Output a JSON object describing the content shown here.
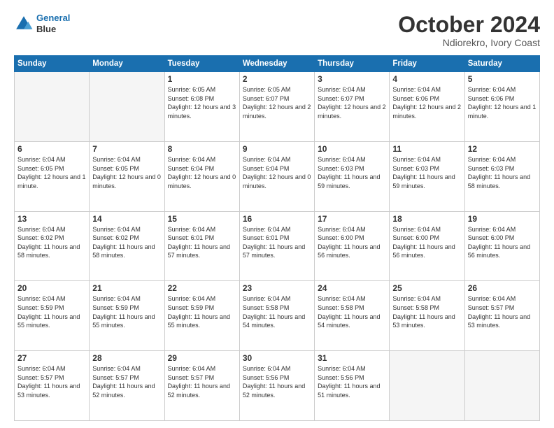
{
  "header": {
    "logo_line1": "General",
    "logo_line2": "Blue",
    "title": "October 2024",
    "subtitle": "Ndiorekro, Ivory Coast"
  },
  "weekdays": [
    "Sunday",
    "Monday",
    "Tuesday",
    "Wednesday",
    "Thursday",
    "Friday",
    "Saturday"
  ],
  "weeks": [
    [
      {
        "num": "",
        "empty": true
      },
      {
        "num": "",
        "empty": true
      },
      {
        "num": "1",
        "sunrise": "6:05 AM",
        "sunset": "6:08 PM",
        "daylight": "12 hours and 3 minutes."
      },
      {
        "num": "2",
        "sunrise": "6:05 AM",
        "sunset": "6:07 PM",
        "daylight": "12 hours and 2 minutes."
      },
      {
        "num": "3",
        "sunrise": "6:04 AM",
        "sunset": "6:07 PM",
        "daylight": "12 hours and 2 minutes."
      },
      {
        "num": "4",
        "sunrise": "6:04 AM",
        "sunset": "6:06 PM",
        "daylight": "12 hours and 2 minutes."
      },
      {
        "num": "5",
        "sunrise": "6:04 AM",
        "sunset": "6:06 PM",
        "daylight": "12 hours and 1 minute."
      }
    ],
    [
      {
        "num": "6",
        "sunrise": "6:04 AM",
        "sunset": "6:05 PM",
        "daylight": "12 hours and 1 minute."
      },
      {
        "num": "7",
        "sunrise": "6:04 AM",
        "sunset": "6:05 PM",
        "daylight": "12 hours and 0 minutes."
      },
      {
        "num": "8",
        "sunrise": "6:04 AM",
        "sunset": "6:04 PM",
        "daylight": "12 hours and 0 minutes."
      },
      {
        "num": "9",
        "sunrise": "6:04 AM",
        "sunset": "6:04 PM",
        "daylight": "12 hours and 0 minutes."
      },
      {
        "num": "10",
        "sunrise": "6:04 AM",
        "sunset": "6:03 PM",
        "daylight": "11 hours and 59 minutes."
      },
      {
        "num": "11",
        "sunrise": "6:04 AM",
        "sunset": "6:03 PM",
        "daylight": "11 hours and 59 minutes."
      },
      {
        "num": "12",
        "sunrise": "6:04 AM",
        "sunset": "6:03 PM",
        "daylight": "11 hours and 58 minutes."
      }
    ],
    [
      {
        "num": "13",
        "sunrise": "6:04 AM",
        "sunset": "6:02 PM",
        "daylight": "11 hours and 58 minutes."
      },
      {
        "num": "14",
        "sunrise": "6:04 AM",
        "sunset": "6:02 PM",
        "daylight": "11 hours and 58 minutes."
      },
      {
        "num": "15",
        "sunrise": "6:04 AM",
        "sunset": "6:01 PM",
        "daylight": "11 hours and 57 minutes."
      },
      {
        "num": "16",
        "sunrise": "6:04 AM",
        "sunset": "6:01 PM",
        "daylight": "11 hours and 57 minutes."
      },
      {
        "num": "17",
        "sunrise": "6:04 AM",
        "sunset": "6:00 PM",
        "daylight": "11 hours and 56 minutes."
      },
      {
        "num": "18",
        "sunrise": "6:04 AM",
        "sunset": "6:00 PM",
        "daylight": "11 hours and 56 minutes."
      },
      {
        "num": "19",
        "sunrise": "6:04 AM",
        "sunset": "6:00 PM",
        "daylight": "11 hours and 56 minutes."
      }
    ],
    [
      {
        "num": "20",
        "sunrise": "6:04 AM",
        "sunset": "5:59 PM",
        "daylight": "11 hours and 55 minutes."
      },
      {
        "num": "21",
        "sunrise": "6:04 AM",
        "sunset": "5:59 PM",
        "daylight": "11 hours and 55 minutes."
      },
      {
        "num": "22",
        "sunrise": "6:04 AM",
        "sunset": "5:59 PM",
        "daylight": "11 hours and 55 minutes."
      },
      {
        "num": "23",
        "sunrise": "6:04 AM",
        "sunset": "5:58 PM",
        "daylight": "11 hours and 54 minutes."
      },
      {
        "num": "24",
        "sunrise": "6:04 AM",
        "sunset": "5:58 PM",
        "daylight": "11 hours and 54 minutes."
      },
      {
        "num": "25",
        "sunrise": "6:04 AM",
        "sunset": "5:58 PM",
        "daylight": "11 hours and 53 minutes."
      },
      {
        "num": "26",
        "sunrise": "6:04 AM",
        "sunset": "5:57 PM",
        "daylight": "11 hours and 53 minutes."
      }
    ],
    [
      {
        "num": "27",
        "sunrise": "6:04 AM",
        "sunset": "5:57 PM",
        "daylight": "11 hours and 53 minutes."
      },
      {
        "num": "28",
        "sunrise": "6:04 AM",
        "sunset": "5:57 PM",
        "daylight": "11 hours and 52 minutes."
      },
      {
        "num": "29",
        "sunrise": "6:04 AM",
        "sunset": "5:57 PM",
        "daylight": "11 hours and 52 minutes."
      },
      {
        "num": "30",
        "sunrise": "6:04 AM",
        "sunset": "5:56 PM",
        "daylight": "11 hours and 52 minutes."
      },
      {
        "num": "31",
        "sunrise": "6:04 AM",
        "sunset": "5:56 PM",
        "daylight": "11 hours and 51 minutes."
      },
      {
        "num": "",
        "empty": true
      },
      {
        "num": "",
        "empty": true
      }
    ]
  ]
}
